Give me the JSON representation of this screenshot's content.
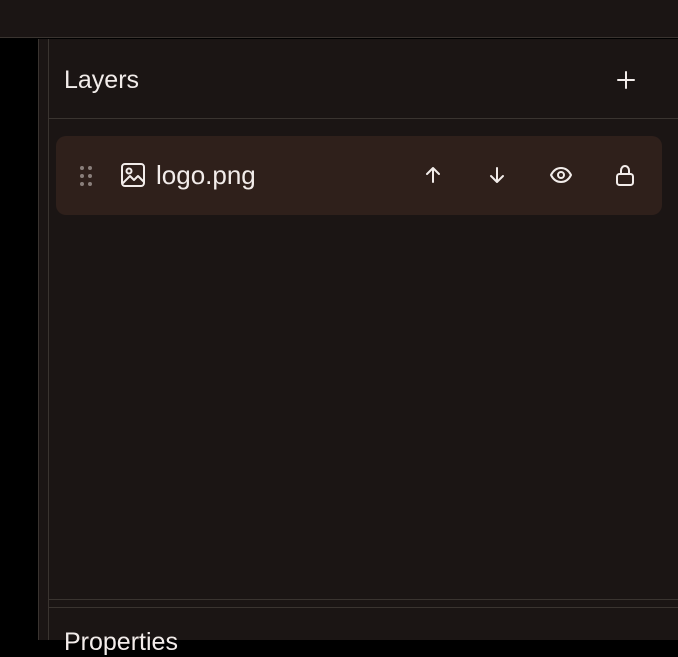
{
  "colors": {
    "background": "#1b1514",
    "canvas": "#000000",
    "border": "#3a3430",
    "layer_row": "#2f201b",
    "text": "#f2ecea",
    "muted": "#8a7f7b"
  },
  "layers_panel": {
    "title": "Layers",
    "add_icon": "plus-icon",
    "items": [
      {
        "name": "logo.png",
        "type_icon": "image-icon",
        "handle_icon": "drag-handle-icon",
        "actions": [
          "arrow-up-icon",
          "arrow-down-icon",
          "eye-icon",
          "lock-icon"
        ]
      }
    ]
  },
  "properties_panel": {
    "title": "Properties"
  }
}
